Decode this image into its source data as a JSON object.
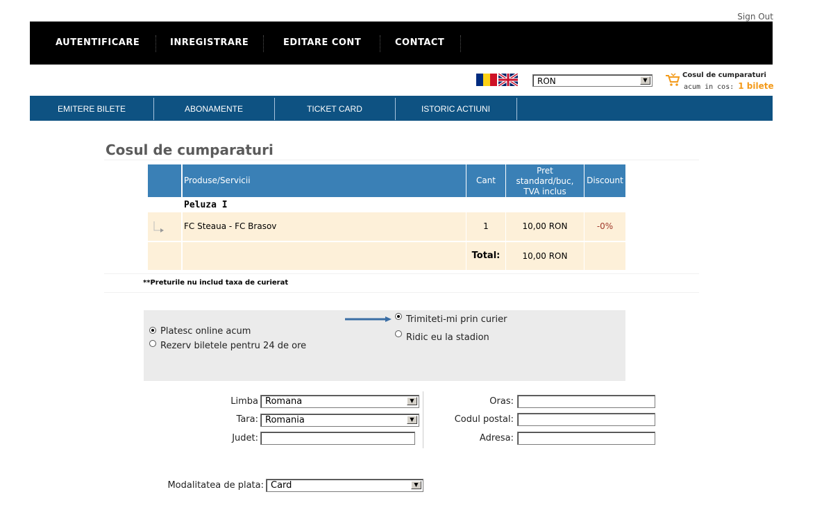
{
  "header": {
    "sign_out": "Sign Out"
  },
  "top_nav": [
    "AUTENTIFICARE",
    "INREGISTRARE",
    "EDITARE CONT",
    "CONTACT"
  ],
  "currency": {
    "selected": "RON"
  },
  "cart": {
    "title": "Cosul de cumparaturi",
    "prefix": "acum in cos:",
    "count": "1 bilete"
  },
  "sub_nav": [
    "EMITERE BILETE",
    "ABONAMENTE",
    "TICKET CARD",
    "ISTORIC ACTIUNI"
  ],
  "page_title": "Cosul de cumparaturi",
  "table": {
    "headers": {
      "product": "Produse/Servicii",
      "qty": "Cant",
      "price_l1": "Pret",
      "price_l2": "standard/buc,",
      "price_l3": "TVA inclus",
      "discount": "Discount"
    },
    "group": "Peluza I",
    "row": {
      "product": "FC Steaua - FC Brasov",
      "qty": "1",
      "price": "10,00 RON",
      "discount": "-0%"
    },
    "total_label": "Total:",
    "total_value": "10,00 RON"
  },
  "note": "**Preturile nu includ taxa de curierat",
  "payment_options": [
    {
      "label": "Platesc online acum",
      "checked": true
    },
    {
      "label": "Rezerv biletele pentru 24 de ore",
      "checked": false
    }
  ],
  "delivery_options": [
    {
      "label": "Trimiteti-mi prin curier",
      "checked": true
    },
    {
      "label": "Ridic eu la stadion",
      "checked": false
    }
  ],
  "form": {
    "limba_label": "Limba",
    "limba_value": "Romana",
    "tara_label": "Tara:",
    "tara_value": "Romania",
    "judet_label": "Judet:",
    "judet_value": "",
    "oras_label": "Oras:",
    "oras_value": "",
    "cod_label": "Codul postal:",
    "cod_value": "",
    "adresa_label": "Adresa:",
    "adresa_value": "",
    "plata_label": "Modalitatea de plata:",
    "plata_value": "Card"
  },
  "colors": {
    "nav_black": "#000000",
    "nav_blue": "#0e5282",
    "table_header": "#3a80b6",
    "row_pale": "#fdf0d9",
    "accent_orange": "#f39a1a"
  }
}
